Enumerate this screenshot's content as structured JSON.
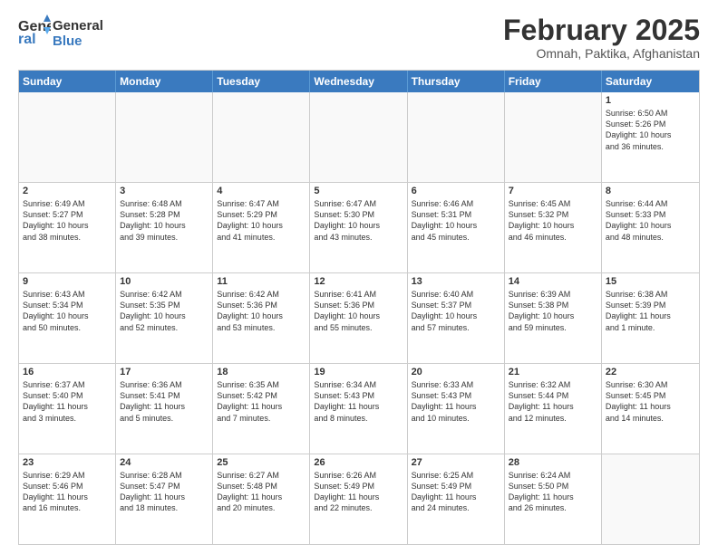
{
  "header": {
    "logo_line1": "General",
    "logo_line2": "Blue",
    "title": "February 2025",
    "subtitle": "Omnah, Paktika, Afghanistan"
  },
  "dayHeaders": [
    "Sunday",
    "Monday",
    "Tuesday",
    "Wednesday",
    "Thursday",
    "Friday",
    "Saturday"
  ],
  "weeks": [
    [
      {
        "num": "",
        "info": ""
      },
      {
        "num": "",
        "info": ""
      },
      {
        "num": "",
        "info": ""
      },
      {
        "num": "",
        "info": ""
      },
      {
        "num": "",
        "info": ""
      },
      {
        "num": "",
        "info": ""
      },
      {
        "num": "1",
        "info": "Sunrise: 6:50 AM\nSunset: 5:26 PM\nDaylight: 10 hours\nand 36 minutes."
      }
    ],
    [
      {
        "num": "2",
        "info": "Sunrise: 6:49 AM\nSunset: 5:27 PM\nDaylight: 10 hours\nand 38 minutes."
      },
      {
        "num": "3",
        "info": "Sunrise: 6:48 AM\nSunset: 5:28 PM\nDaylight: 10 hours\nand 39 minutes."
      },
      {
        "num": "4",
        "info": "Sunrise: 6:47 AM\nSunset: 5:29 PM\nDaylight: 10 hours\nand 41 minutes."
      },
      {
        "num": "5",
        "info": "Sunrise: 6:47 AM\nSunset: 5:30 PM\nDaylight: 10 hours\nand 43 minutes."
      },
      {
        "num": "6",
        "info": "Sunrise: 6:46 AM\nSunset: 5:31 PM\nDaylight: 10 hours\nand 45 minutes."
      },
      {
        "num": "7",
        "info": "Sunrise: 6:45 AM\nSunset: 5:32 PM\nDaylight: 10 hours\nand 46 minutes."
      },
      {
        "num": "8",
        "info": "Sunrise: 6:44 AM\nSunset: 5:33 PM\nDaylight: 10 hours\nand 48 minutes."
      }
    ],
    [
      {
        "num": "9",
        "info": "Sunrise: 6:43 AM\nSunset: 5:34 PM\nDaylight: 10 hours\nand 50 minutes."
      },
      {
        "num": "10",
        "info": "Sunrise: 6:42 AM\nSunset: 5:35 PM\nDaylight: 10 hours\nand 52 minutes."
      },
      {
        "num": "11",
        "info": "Sunrise: 6:42 AM\nSunset: 5:36 PM\nDaylight: 10 hours\nand 53 minutes."
      },
      {
        "num": "12",
        "info": "Sunrise: 6:41 AM\nSunset: 5:36 PM\nDaylight: 10 hours\nand 55 minutes."
      },
      {
        "num": "13",
        "info": "Sunrise: 6:40 AM\nSunset: 5:37 PM\nDaylight: 10 hours\nand 57 minutes."
      },
      {
        "num": "14",
        "info": "Sunrise: 6:39 AM\nSunset: 5:38 PM\nDaylight: 10 hours\nand 59 minutes."
      },
      {
        "num": "15",
        "info": "Sunrise: 6:38 AM\nSunset: 5:39 PM\nDaylight: 11 hours\nand 1 minute."
      }
    ],
    [
      {
        "num": "16",
        "info": "Sunrise: 6:37 AM\nSunset: 5:40 PM\nDaylight: 11 hours\nand 3 minutes."
      },
      {
        "num": "17",
        "info": "Sunrise: 6:36 AM\nSunset: 5:41 PM\nDaylight: 11 hours\nand 5 minutes."
      },
      {
        "num": "18",
        "info": "Sunrise: 6:35 AM\nSunset: 5:42 PM\nDaylight: 11 hours\nand 7 minutes."
      },
      {
        "num": "19",
        "info": "Sunrise: 6:34 AM\nSunset: 5:43 PM\nDaylight: 11 hours\nand 8 minutes."
      },
      {
        "num": "20",
        "info": "Sunrise: 6:33 AM\nSunset: 5:43 PM\nDaylight: 11 hours\nand 10 minutes."
      },
      {
        "num": "21",
        "info": "Sunrise: 6:32 AM\nSunset: 5:44 PM\nDaylight: 11 hours\nand 12 minutes."
      },
      {
        "num": "22",
        "info": "Sunrise: 6:30 AM\nSunset: 5:45 PM\nDaylight: 11 hours\nand 14 minutes."
      }
    ],
    [
      {
        "num": "23",
        "info": "Sunrise: 6:29 AM\nSunset: 5:46 PM\nDaylight: 11 hours\nand 16 minutes."
      },
      {
        "num": "24",
        "info": "Sunrise: 6:28 AM\nSunset: 5:47 PM\nDaylight: 11 hours\nand 18 minutes."
      },
      {
        "num": "25",
        "info": "Sunrise: 6:27 AM\nSunset: 5:48 PM\nDaylight: 11 hours\nand 20 minutes."
      },
      {
        "num": "26",
        "info": "Sunrise: 6:26 AM\nSunset: 5:49 PM\nDaylight: 11 hours\nand 22 minutes."
      },
      {
        "num": "27",
        "info": "Sunrise: 6:25 AM\nSunset: 5:49 PM\nDaylight: 11 hours\nand 24 minutes."
      },
      {
        "num": "28",
        "info": "Sunrise: 6:24 AM\nSunset: 5:50 PM\nDaylight: 11 hours\nand 26 minutes."
      },
      {
        "num": "",
        "info": ""
      }
    ]
  ]
}
